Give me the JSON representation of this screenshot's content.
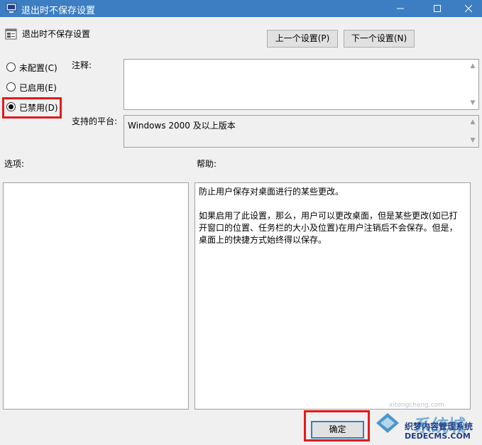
{
  "window": {
    "title": "退出时不保存设置",
    "minimize_glyph": "—",
    "maximize_glyph": "☐",
    "close_glyph": "✕"
  },
  "policy": {
    "name": "退出时不保存设置"
  },
  "nav": {
    "prev_label": "上一个设置(P)",
    "next_label": "下一个设置(N)"
  },
  "state": {
    "options": [
      {
        "label": "未配置(C)",
        "selected": false
      },
      {
        "label": "已启用(E)",
        "selected": false
      },
      {
        "label": "已禁用(D)",
        "selected": true
      }
    ]
  },
  "comment": {
    "label": "注释:",
    "value": ""
  },
  "platform": {
    "label": "支持的平台:",
    "value": "Windows 2000 及以上版本"
  },
  "options_panel": {
    "label": "选项:"
  },
  "help": {
    "label": "帮助:",
    "paragraph1": "防止用户保存对桌面进行的某些更改。",
    "paragraph2": "如果启用了此设置，那么，用户可以更改桌面，但是某些更改(如已打开窗口的位置、任务栏的大小及位置)在用户注销后不会保存。但是，桌面上的快捷方式始终得以保存。"
  },
  "footer": {
    "ok_label": "确定"
  },
  "watermark": {
    "brand": "系统城",
    "site_name": "织梦内容管理系统",
    "domain": "DEDECMS.COM",
    "small": "xitongcheng.com"
  },
  "colors": {
    "titlebar": "#3c7ec1",
    "highlight": "#e21b1b"
  }
}
